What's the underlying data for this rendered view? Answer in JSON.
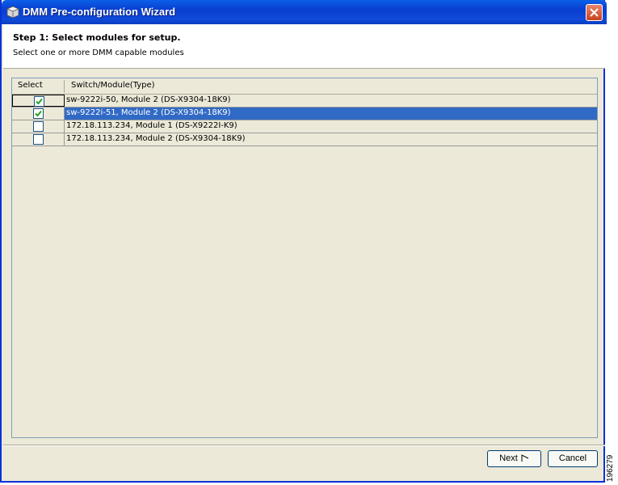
{
  "window": {
    "title": "DMM Pre-configuration Wizard",
    "title_color": "#0a3fd0"
  },
  "header": {
    "step_title": "Step 1: Select modules for setup.",
    "step_subtitle": "Select one or more DMM capable modules"
  },
  "table": {
    "columns": [
      "Select",
      "Switch/Module(Type)"
    ],
    "rows": [
      {
        "checked": true,
        "selected": false,
        "label": "sw-9222i-50, Module 2 (DS-X9304-18K9)"
      },
      {
        "checked": true,
        "selected": true,
        "label": "sw-9222i-51, Module 2 (DS-X9304-18K9)"
      },
      {
        "checked": false,
        "selected": false,
        "label": "172.18.113.234, Module 1 (DS-X9222I-K9)"
      },
      {
        "checked": false,
        "selected": false,
        "label": "172.18.113.234, Module 2 (DS-X9304-18K9)"
      }
    ],
    "selected_color": "#316ac5"
  },
  "buttons": {
    "next": "Next",
    "cancel": "Cancel"
  },
  "figure_id": "196279"
}
